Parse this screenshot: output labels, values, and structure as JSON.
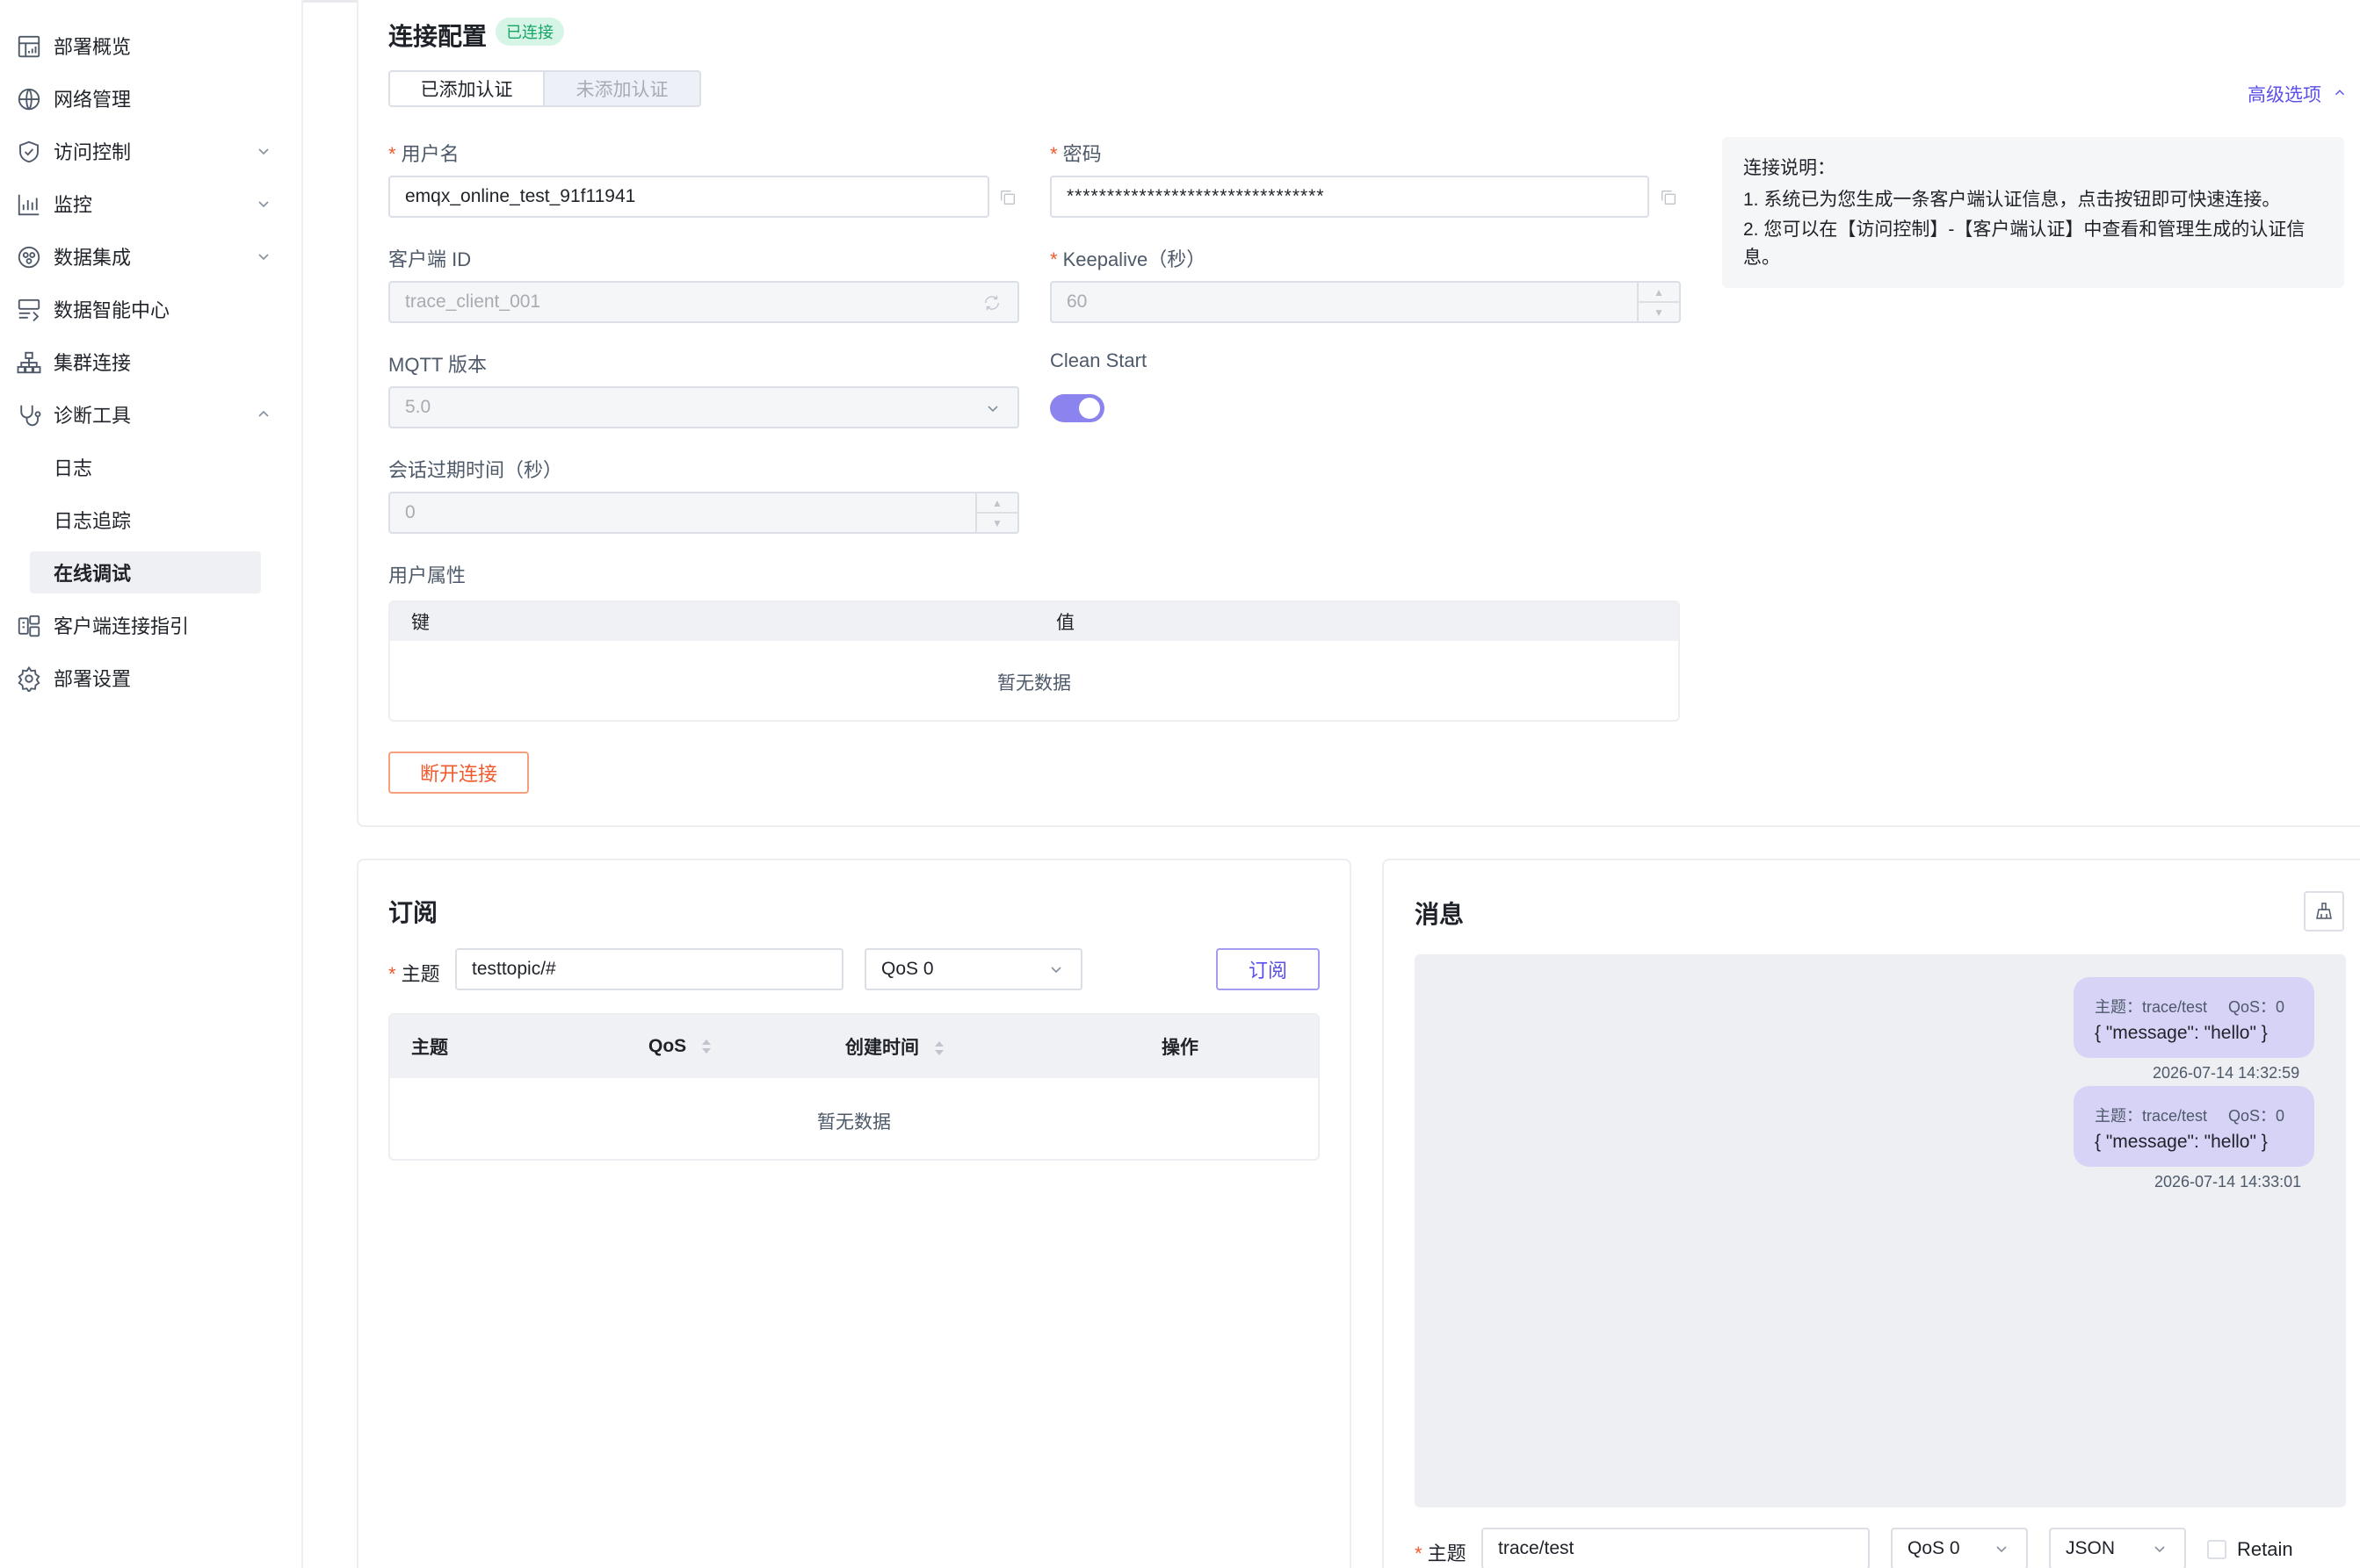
{
  "sidebar": {
    "items": [
      {
        "label": "部署概览",
        "icon": "dashboard-icon"
      },
      {
        "label": "网络管理",
        "icon": "globe-icon"
      },
      {
        "label": "访问控制",
        "icon": "shield-icon",
        "expandable": true
      },
      {
        "label": "监控",
        "icon": "bar-chart-icon",
        "expandable": true
      },
      {
        "label": "数据集成",
        "icon": "integration-icon",
        "expandable": true
      },
      {
        "label": "数据智能中心",
        "icon": "data-center-icon"
      },
      {
        "label": "集群连接",
        "icon": "cluster-icon"
      },
      {
        "label": "诊断工具",
        "icon": "stethoscope-icon",
        "expandable": true,
        "expanded": true
      },
      {
        "label": "客户端连接指引",
        "icon": "client-guide-icon"
      },
      {
        "label": "部署设置",
        "icon": "gear-icon"
      }
    ],
    "diagnose_sub": [
      {
        "label": "日志"
      },
      {
        "label": "日志追踪"
      },
      {
        "label": "在线调试",
        "active": true
      }
    ]
  },
  "connection": {
    "title": "连接配置",
    "status_badge": "已连接",
    "auth_tabs": [
      "已添加认证",
      "未添加认证"
    ],
    "advanced_link": "高级选项",
    "username_label": "用户名",
    "username_value": "emqx_online_test_91f11941",
    "password_label": "密码",
    "password_value": "********************************",
    "client_id_label": "客户端 ID",
    "client_id_value": "trace_client_001",
    "keepalive_label": "Keepalive（秒）",
    "keepalive_value": "60",
    "mqtt_version_label": "MQTT 版本",
    "mqtt_version_value": "5.0",
    "clean_start_label": "Clean Start",
    "clean_start_on": true,
    "session_expiry_label": "会话过期时间（秒）",
    "session_expiry_value": "0",
    "user_props_label": "用户属性",
    "user_props_key_header": "键",
    "user_props_value_header": "值",
    "user_props_empty": "暂无数据",
    "disconnect_button": "断开连接",
    "note_title": "连接说明：",
    "note_line1": "1. 系统已为您生成一条客户端认证信息，点击按钮即可快速连接。",
    "note_line2": "2. 您可以在【访问控制】-【客户端认证】中查看和管理生成的认证信息。"
  },
  "subscribe": {
    "title": "订阅",
    "topic_label": "主题",
    "topic_value": "testtopic/#",
    "qos_value": "QoS 0",
    "subscribe_button": "订阅",
    "columns": [
      "主题",
      "QoS",
      "创建时间",
      "操作"
    ],
    "empty": "暂无数据"
  },
  "messages": {
    "title": "消息",
    "items": [
      {
        "topic": "主题：trace/test",
        "qos": "QoS：0",
        "payload": "{ \"message\": \"hello\" }",
        "time": "2026-07-14 14:32:59"
      },
      {
        "topic": "主题：trace/test",
        "qos": "QoS：0",
        "payload": "{ \"message\": \"hello\" }",
        "time": "2026-07-14 14:33:01"
      }
    ],
    "publish": {
      "topic_label": "主题",
      "topic_value": "trace/test",
      "qos_value": "QoS 0",
      "format_value": "JSON",
      "retain_label": "Retain"
    }
  },
  "colors": {
    "accent": "#5b4fe9",
    "success": "#17a567",
    "danger": "#f05a2c",
    "toggle": "#8c84ee"
  }
}
